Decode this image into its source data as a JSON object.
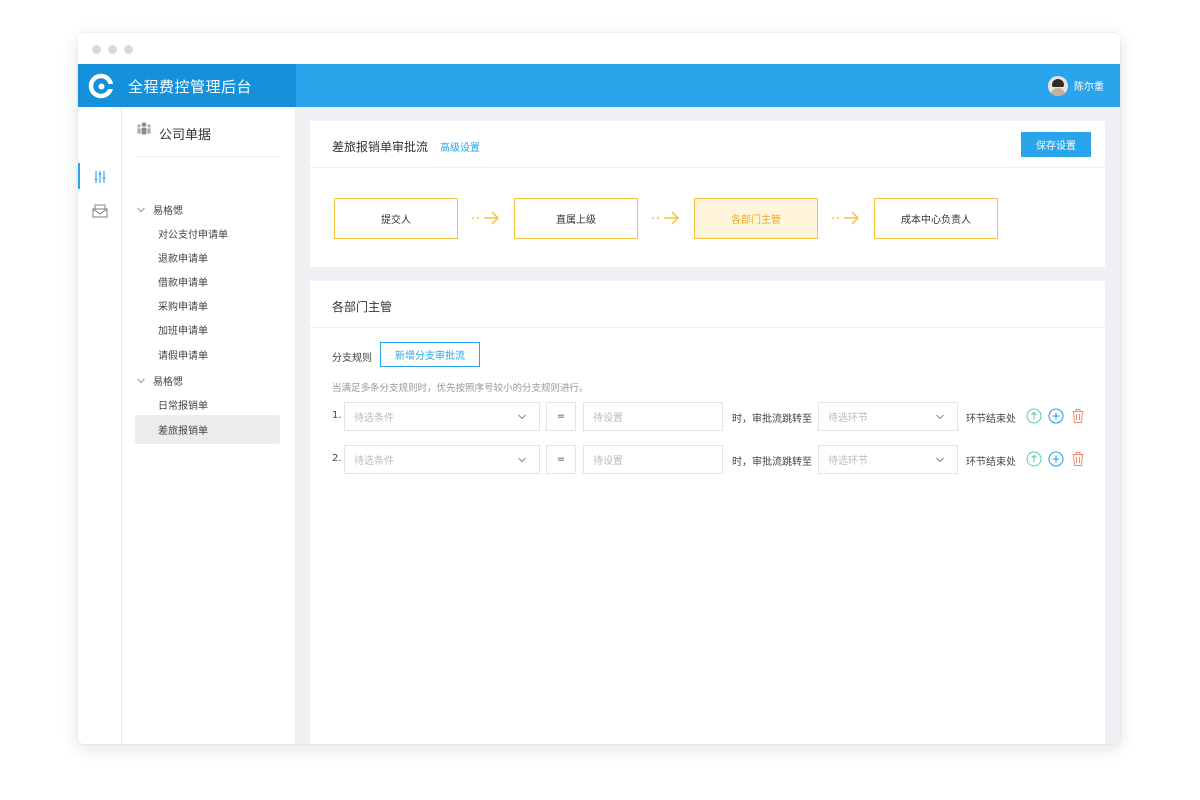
{
  "app": {
    "title": "全程费控管理后台",
    "user_name": "陈尔重"
  },
  "colors": {
    "primary": "#2aa4ea",
    "brand_dark": "#1591dc",
    "flow_border": "#f5c342",
    "flow_current_text": "#f0a818",
    "delete": "#f08a6a",
    "up": "#4fcfae"
  },
  "nav": {
    "header": "公司单据",
    "groups": [
      {
        "label": "易格愢",
        "items": [
          "对公支付申请单",
          "退款申请单",
          "借款申请单",
          "采购申请单",
          "加班申请单",
          "请假申请单"
        ]
      },
      {
        "label": "易格愢",
        "items": [
          "日常报销单",
          "差旅报销单"
        ]
      }
    ],
    "active_item": "差旅报销单"
  },
  "flow_card": {
    "title": "差旅报销单审批流",
    "advanced_link": "高级设置",
    "save_button": "保存设置",
    "nodes": [
      "提交人",
      "直属上级",
      "各部门主管",
      "成本中心负责人"
    ],
    "current_node_index": 2
  },
  "branch_card": {
    "title": "各部门主管",
    "branch_rules_label": "分支规则",
    "add_branch_button": "新增分支审批流",
    "hint": "当满足多条分支规则时，优先按照序号较小的分支规则进行。",
    "rows": [
      {
        "num": "1.",
        "condition_placeholder": "待选条件",
        "operator": "=",
        "value_placeholder": "待设置",
        "jump_text": "时，审批流跳转至",
        "step_placeholder": "待选环节",
        "end_text": "环节结束处"
      },
      {
        "num": "2.",
        "condition_placeholder": "待选条件",
        "operator": "=",
        "value_placeholder": "待设置",
        "jump_text": "时，审批流跳转至",
        "step_placeholder": "待选环节",
        "end_text": "环节结束处"
      }
    ]
  }
}
